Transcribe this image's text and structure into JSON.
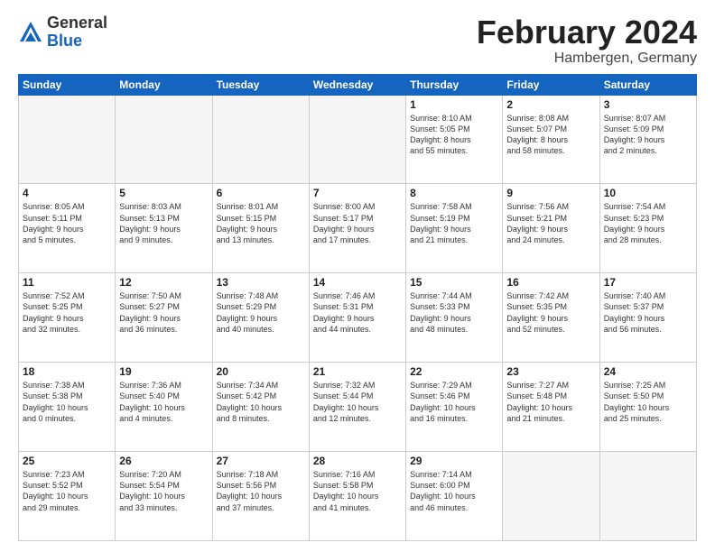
{
  "logo": {
    "general": "General",
    "blue": "Blue"
  },
  "title": {
    "month": "February 2024",
    "location": "Hambergen, Germany"
  },
  "headers": [
    "Sunday",
    "Monday",
    "Tuesday",
    "Wednesday",
    "Thursday",
    "Friday",
    "Saturday"
  ],
  "weeks": [
    [
      {
        "day": "",
        "info": ""
      },
      {
        "day": "",
        "info": ""
      },
      {
        "day": "",
        "info": ""
      },
      {
        "day": "",
        "info": ""
      },
      {
        "day": "1",
        "info": "Sunrise: 8:10 AM\nSunset: 5:05 PM\nDaylight: 8 hours\nand 55 minutes."
      },
      {
        "day": "2",
        "info": "Sunrise: 8:08 AM\nSunset: 5:07 PM\nDaylight: 8 hours\nand 58 minutes."
      },
      {
        "day": "3",
        "info": "Sunrise: 8:07 AM\nSunset: 5:09 PM\nDaylight: 9 hours\nand 2 minutes."
      }
    ],
    [
      {
        "day": "4",
        "info": "Sunrise: 8:05 AM\nSunset: 5:11 PM\nDaylight: 9 hours\nand 5 minutes."
      },
      {
        "day": "5",
        "info": "Sunrise: 8:03 AM\nSunset: 5:13 PM\nDaylight: 9 hours\nand 9 minutes."
      },
      {
        "day": "6",
        "info": "Sunrise: 8:01 AM\nSunset: 5:15 PM\nDaylight: 9 hours\nand 13 minutes."
      },
      {
        "day": "7",
        "info": "Sunrise: 8:00 AM\nSunset: 5:17 PM\nDaylight: 9 hours\nand 17 minutes."
      },
      {
        "day": "8",
        "info": "Sunrise: 7:58 AM\nSunset: 5:19 PM\nDaylight: 9 hours\nand 21 minutes."
      },
      {
        "day": "9",
        "info": "Sunrise: 7:56 AM\nSunset: 5:21 PM\nDaylight: 9 hours\nand 24 minutes."
      },
      {
        "day": "10",
        "info": "Sunrise: 7:54 AM\nSunset: 5:23 PM\nDaylight: 9 hours\nand 28 minutes."
      }
    ],
    [
      {
        "day": "11",
        "info": "Sunrise: 7:52 AM\nSunset: 5:25 PM\nDaylight: 9 hours\nand 32 minutes."
      },
      {
        "day": "12",
        "info": "Sunrise: 7:50 AM\nSunset: 5:27 PM\nDaylight: 9 hours\nand 36 minutes."
      },
      {
        "day": "13",
        "info": "Sunrise: 7:48 AM\nSunset: 5:29 PM\nDaylight: 9 hours\nand 40 minutes."
      },
      {
        "day": "14",
        "info": "Sunrise: 7:46 AM\nSunset: 5:31 PM\nDaylight: 9 hours\nand 44 minutes."
      },
      {
        "day": "15",
        "info": "Sunrise: 7:44 AM\nSunset: 5:33 PM\nDaylight: 9 hours\nand 48 minutes."
      },
      {
        "day": "16",
        "info": "Sunrise: 7:42 AM\nSunset: 5:35 PM\nDaylight: 9 hours\nand 52 minutes."
      },
      {
        "day": "17",
        "info": "Sunrise: 7:40 AM\nSunset: 5:37 PM\nDaylight: 9 hours\nand 56 minutes."
      }
    ],
    [
      {
        "day": "18",
        "info": "Sunrise: 7:38 AM\nSunset: 5:38 PM\nDaylight: 10 hours\nand 0 minutes."
      },
      {
        "day": "19",
        "info": "Sunrise: 7:36 AM\nSunset: 5:40 PM\nDaylight: 10 hours\nand 4 minutes."
      },
      {
        "day": "20",
        "info": "Sunrise: 7:34 AM\nSunset: 5:42 PM\nDaylight: 10 hours\nand 8 minutes."
      },
      {
        "day": "21",
        "info": "Sunrise: 7:32 AM\nSunset: 5:44 PM\nDaylight: 10 hours\nand 12 minutes."
      },
      {
        "day": "22",
        "info": "Sunrise: 7:29 AM\nSunset: 5:46 PM\nDaylight: 10 hours\nand 16 minutes."
      },
      {
        "day": "23",
        "info": "Sunrise: 7:27 AM\nSunset: 5:48 PM\nDaylight: 10 hours\nand 21 minutes."
      },
      {
        "day": "24",
        "info": "Sunrise: 7:25 AM\nSunset: 5:50 PM\nDaylight: 10 hours\nand 25 minutes."
      }
    ],
    [
      {
        "day": "25",
        "info": "Sunrise: 7:23 AM\nSunset: 5:52 PM\nDaylight: 10 hours\nand 29 minutes."
      },
      {
        "day": "26",
        "info": "Sunrise: 7:20 AM\nSunset: 5:54 PM\nDaylight: 10 hours\nand 33 minutes."
      },
      {
        "day": "27",
        "info": "Sunrise: 7:18 AM\nSunset: 5:56 PM\nDaylight: 10 hours\nand 37 minutes."
      },
      {
        "day": "28",
        "info": "Sunrise: 7:16 AM\nSunset: 5:58 PM\nDaylight: 10 hours\nand 41 minutes."
      },
      {
        "day": "29",
        "info": "Sunrise: 7:14 AM\nSunset: 6:00 PM\nDaylight: 10 hours\nand 46 minutes."
      },
      {
        "day": "",
        "info": ""
      },
      {
        "day": "",
        "info": ""
      }
    ]
  ]
}
